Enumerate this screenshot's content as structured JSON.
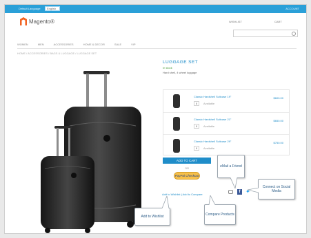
{
  "topbar": {
    "language_label": "Default Language",
    "language_value": "English",
    "account_label": "ACCOUNT"
  },
  "brand": {
    "logo_text": "Magento®"
  },
  "header": {
    "wishlist_label": "WISHLIST",
    "cart_label": "CART",
    "search_placeholder": ""
  },
  "nav": {
    "items": [
      "WOMEN",
      "MEN",
      "ACCESSORIES",
      "HOME & DECOR",
      "SALE",
      "VIP"
    ]
  },
  "breadcrumb": "HOME / ACCESSORIES / BAGS & LUGGAGE / LUGGAGE SET",
  "product": {
    "title": "LUGGAGE SET",
    "stock": "In stock",
    "short_description": "Hard shell, 4 wheel luggage",
    "grouped_items": [
      {
        "name": "Classic Hardshell Suitcase 19\"",
        "qty": "0",
        "desc": "Available",
        "price": "$600.00"
      },
      {
        "name": "Classic Hardshell Suitcase 21\"",
        "qty": "0",
        "desc": "Available",
        "price": "$650.00"
      },
      {
        "name": "Classic Hardshell Suitcase 29\"",
        "qty": "0",
        "desc": "Available",
        "price": "$750.00"
      }
    ],
    "add_to_cart_label": "ADD TO CART",
    "or_label": "OR",
    "paypal_label": "PayPal Checkout",
    "wishlist_compare_label": "Add to Wishlist | Add to Compare"
  },
  "callouts": {
    "email_friend": "eMail a Friend",
    "connect_social": "Connect on Social Media",
    "add_wishlist": "Add to Wishlist",
    "compare_products": "Compare Products"
  },
  "icons": {
    "email": "email-icon",
    "facebook": "facebook-icon",
    "twitter": "twitter-icon"
  },
  "colors": {
    "accent": "#1f8dc9",
    "topbar": "#2aa0d8",
    "brand": "#f26322"
  }
}
